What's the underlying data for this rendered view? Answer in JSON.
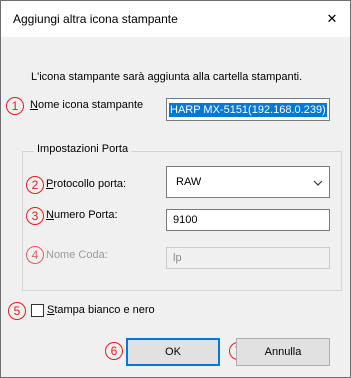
{
  "dialog": {
    "title": "Aggiungi altra icona stampante",
    "close_glyph": "✕",
    "info": "L'icona stampante sarà aggiunta alla cartella stampanti."
  },
  "printer_name": {
    "label": "Nome icona stampante",
    "value": "HARP MX-5151(192.168.0.239)"
  },
  "port_group": {
    "label": "Impostazioni Porta",
    "protocol_label": "Protocollo porta:",
    "protocol_value": "RAW",
    "port_number_label": "Numero Porta:",
    "port_number_value": "9100",
    "queue_label": "Nome Coda:",
    "queue_value": "lp"
  },
  "mono_checkbox": {
    "label": "Stampa bianco e nero",
    "checked": false
  },
  "buttons": {
    "ok": "OK",
    "cancel": "Annulla"
  },
  "annotations": [
    "1",
    "2",
    "3",
    "4",
    "5",
    "6",
    "7"
  ],
  "colors": {
    "annotation": "#e02020",
    "selection": "#0078d7",
    "dialog_bg": "#f0f0f0"
  }
}
